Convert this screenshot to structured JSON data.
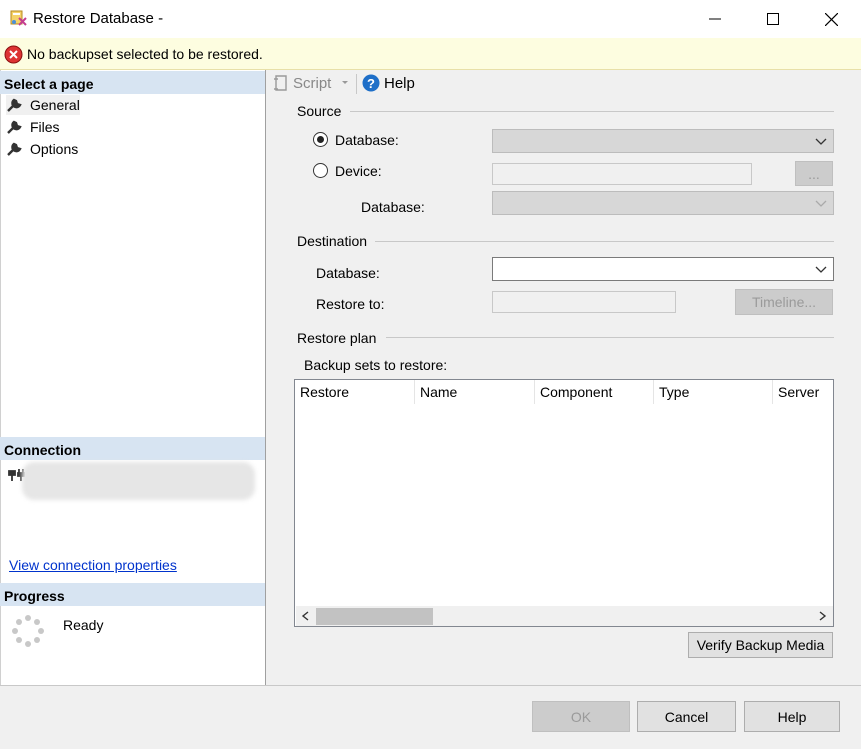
{
  "window": {
    "title": "Restore Database -",
    "minimize_icon": "minimize-icon",
    "maximize_icon": "maximize-icon",
    "close_icon": "close-icon"
  },
  "error_banner": {
    "icon": "error-icon",
    "message": "No backupset selected to be restored."
  },
  "left_pane": {
    "select_page_header": "Select a page",
    "pages": [
      {
        "label": "General"
      },
      {
        "label": "Files"
      },
      {
        "label": "Options"
      }
    ],
    "connection_header": "Connection",
    "view_connection_link": "View connection properties",
    "progress_header": "Progress",
    "progress_status": "Ready"
  },
  "toolbar": {
    "script_label": "Script",
    "help_label": "Help"
  },
  "source": {
    "group_label": "Source",
    "database_radio_label": "Database:",
    "device_radio_label": "Device:",
    "device_browse_label": "...",
    "sub_database_label": "Database:",
    "selected": "database"
  },
  "destination": {
    "group_label": "Destination",
    "database_label": "Database:",
    "restore_to_label": "Restore to:",
    "timeline_button": "Timeline..."
  },
  "restore_plan": {
    "group_label": "Restore plan",
    "backup_sets_label": "Backup sets to restore:",
    "columns": [
      "Restore",
      "Name",
      "Component",
      "Type",
      "Server"
    ],
    "verify_button": "Verify Backup Media"
  },
  "footer": {
    "ok_label": "OK",
    "cancel_label": "Cancel",
    "help_label": "Help"
  }
}
